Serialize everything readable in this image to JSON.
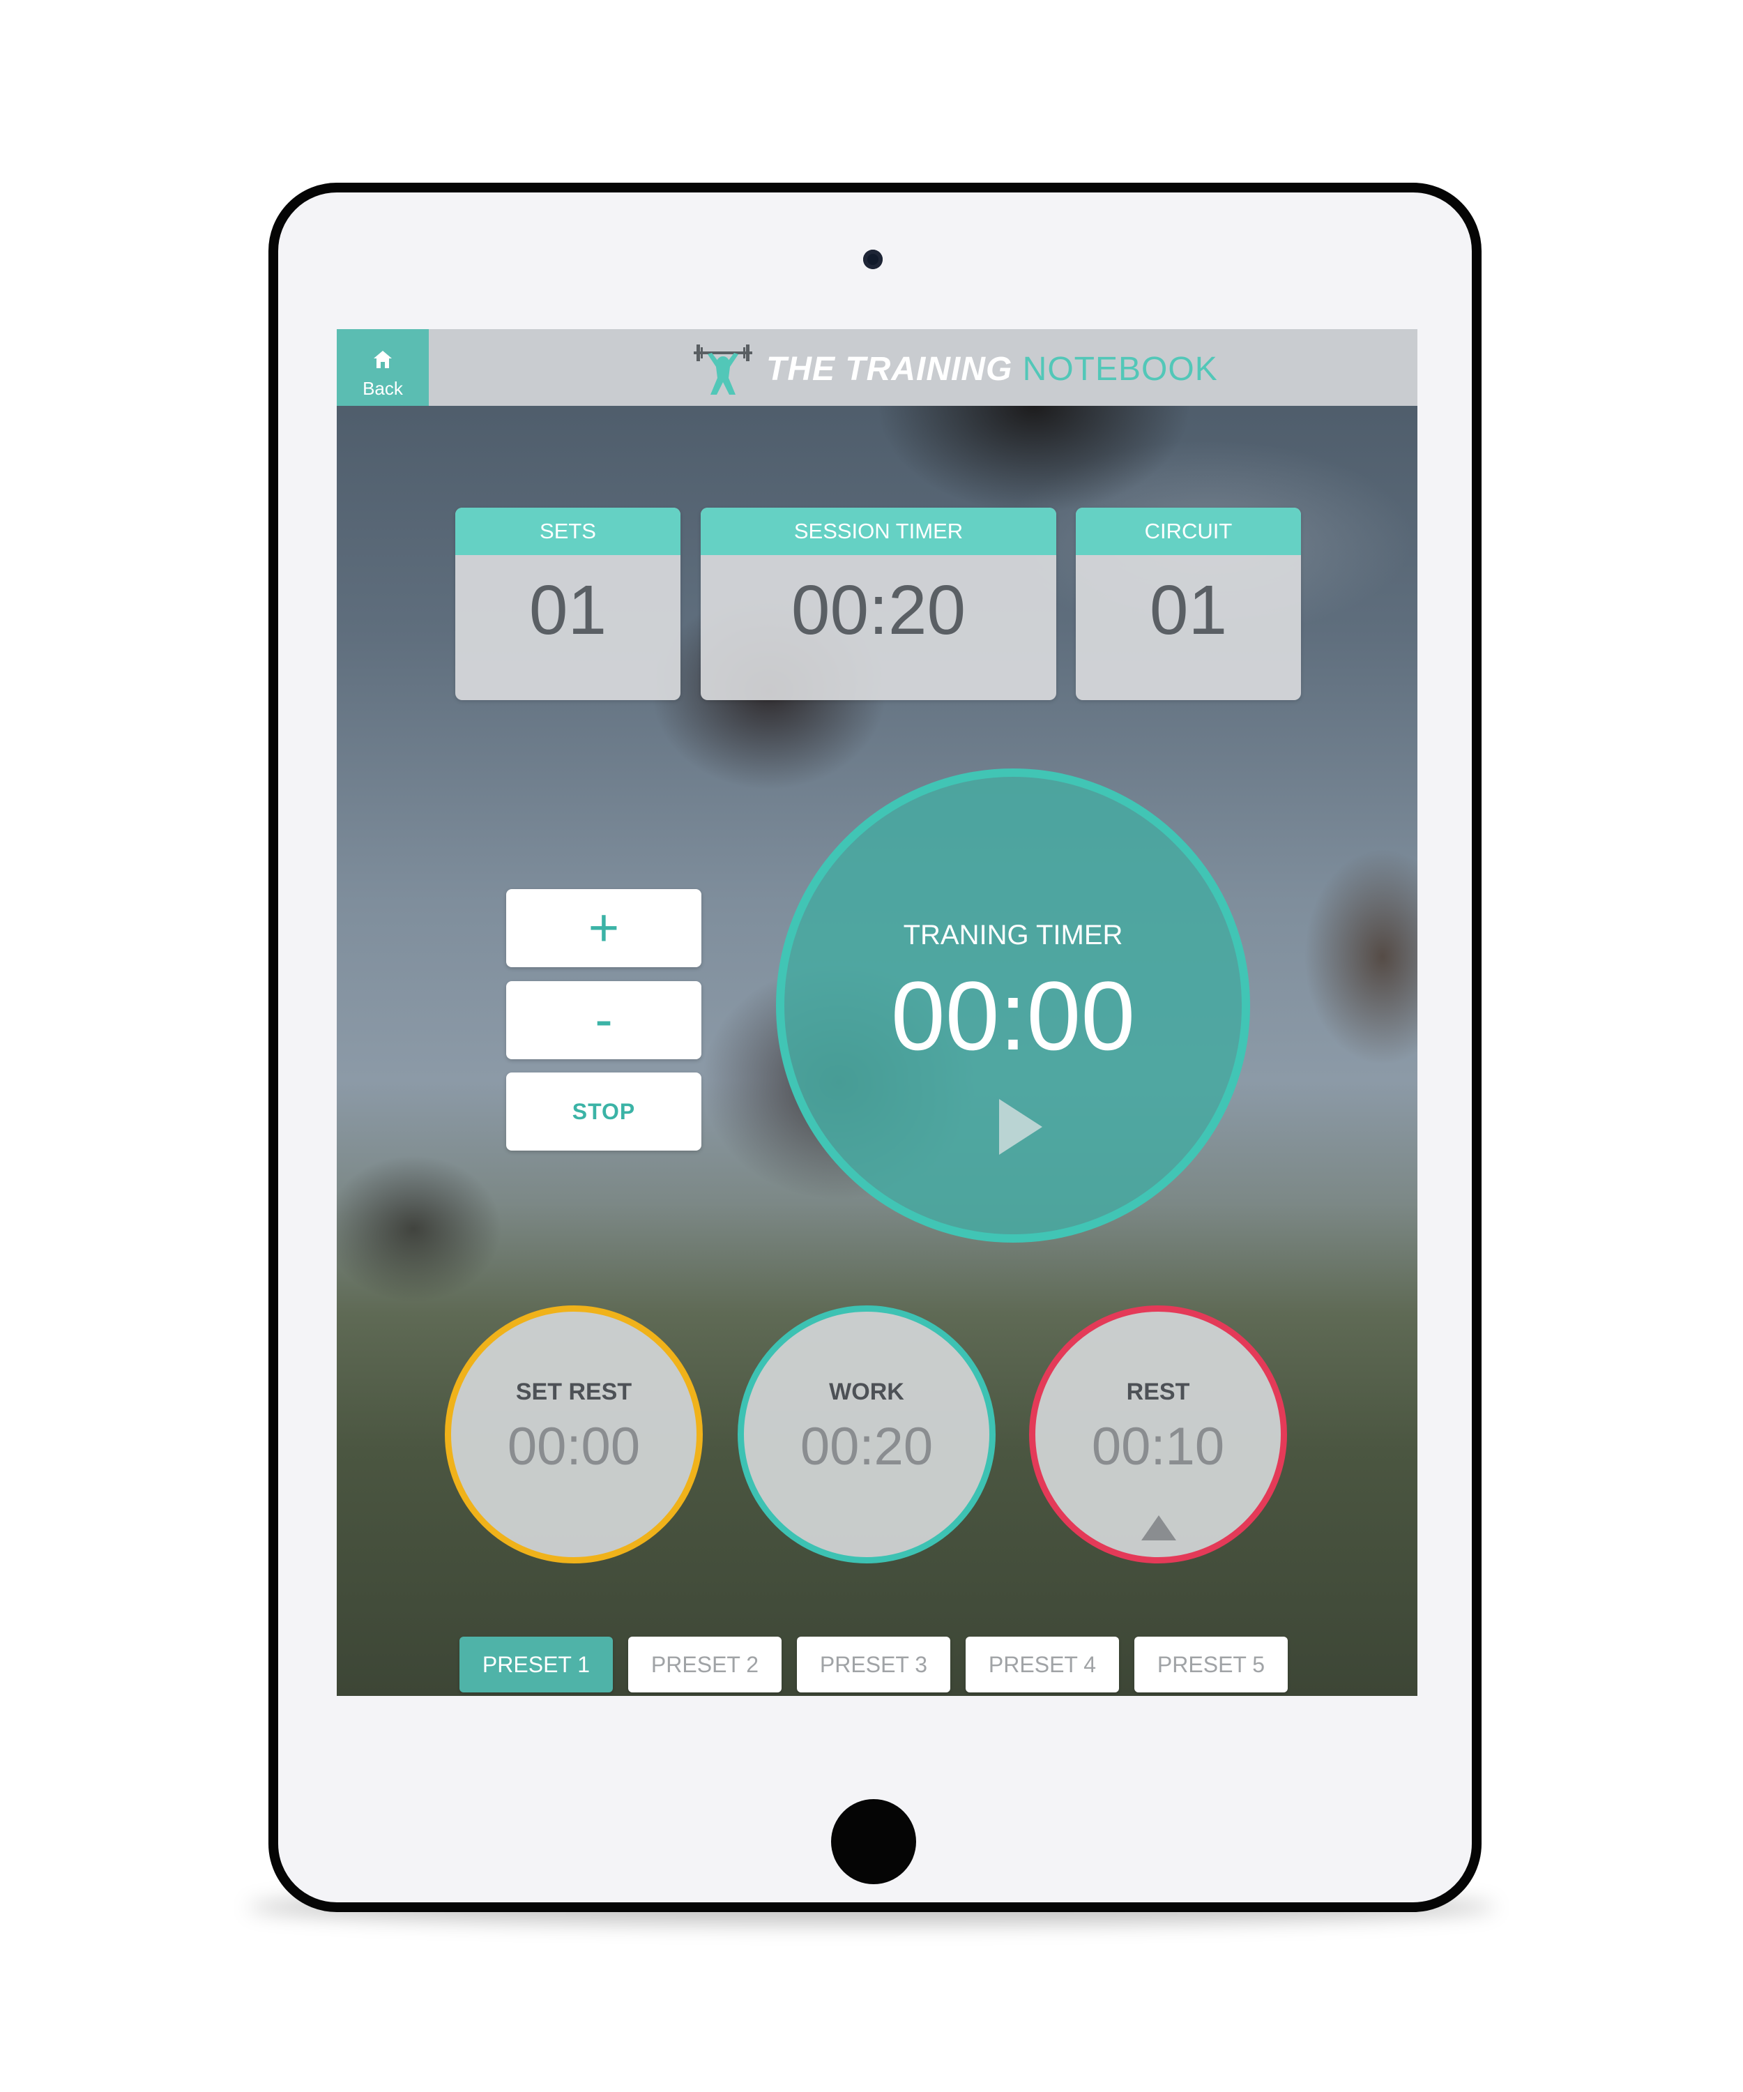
{
  "header": {
    "back_label": "Back",
    "brand_strong": "THE TRAINING",
    "brand_light": "NOTEBOOK"
  },
  "stats": {
    "sets": {
      "label": "SETS",
      "value": "01"
    },
    "session": {
      "label": "SESSION TIMER",
      "value": "00:20"
    },
    "circuit": {
      "label": "CIRCUIT",
      "value": "01"
    }
  },
  "controls": {
    "plus": "+",
    "minus": "-",
    "stop": "STOP"
  },
  "main_timer": {
    "title": "TRANING TIMER",
    "value": "00:00"
  },
  "intervals": {
    "set_rest": {
      "title": "SET REST",
      "value": "00:00",
      "color": "#f0b21a"
    },
    "work": {
      "title": "WORK",
      "value": "00:20",
      "color": "#3dc2b3"
    },
    "rest": {
      "title": "REST",
      "value": "00:10",
      "color": "#e43a58"
    }
  },
  "presets": [
    "PRESET 1",
    "PRESET 2",
    "PRESET 3",
    "PRESET 4",
    "PRESET 5"
  ],
  "selected_preset": "PRESET 1",
  "colors": {
    "accent": "#5bbdb2",
    "header_bg": "#c9ccd0"
  },
  "icons": {
    "back": "home-icon",
    "brand": "weightlifter-logo-icon",
    "play": "play-icon",
    "triangle": "triangle-up-icon"
  }
}
